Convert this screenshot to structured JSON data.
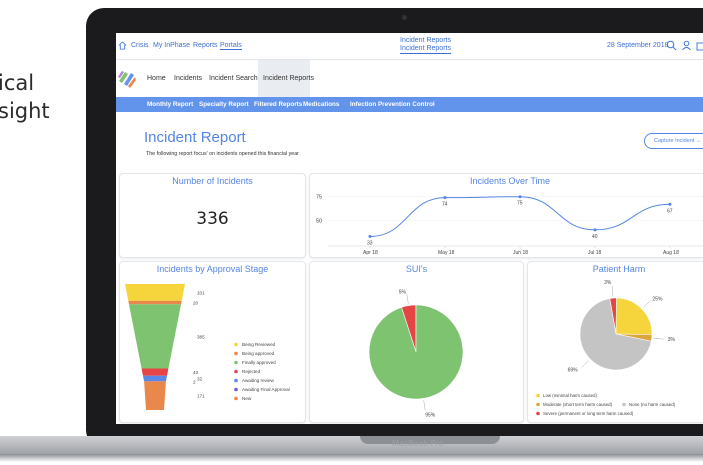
{
  "background_text": [
    "ical",
    "sight"
  ],
  "laptop_label": "MacBook Pro",
  "topbar": {
    "crumbs": [
      "Crisis",
      "My InPhase",
      "Reports",
      "Portals"
    ],
    "center_line1": "Incident Reports",
    "center_line2": "Incident Reports",
    "date": "28 September 2018"
  },
  "nav": [
    "Home",
    "Incidents",
    "Incident Search",
    "Incident Reports"
  ],
  "subnav": [
    "Monthly Report",
    "Specialty Report",
    "Filtered Reports",
    "Medications",
    "Infection Prevention Control"
  ],
  "page": {
    "title": "Incident Report",
    "subtitle": "The following report focus' on incidents opened this financial year",
    "capture_label": "Capture Incident →"
  },
  "cards": {
    "num_title": "Number of Incidents",
    "num_value": "336",
    "time_title": "Incidents Over Time",
    "funnel_title": "Incidents by Approval Stage",
    "sui_title": "SUI's",
    "harm_title": "Patient Harm"
  },
  "colors": {
    "accent": "#5585e6",
    "bluebar": "#6394ec",
    "green": "#7ec36f",
    "red": "#e54545",
    "yellow": "#f5d53b",
    "orange": "#e8884a",
    "purple": "#7b5cd6",
    "gold": "#d9a73b",
    "gray": "#c4c4c4"
  },
  "chart_data": [
    {
      "type": "line",
      "title": "Incidents Over Time",
      "x": [
        "Apr 18",
        "May 18",
        "Jun 18",
        "Jul 18",
        "Aug 18"
      ],
      "values": [
        33,
        74,
        75,
        40,
        67
      ],
      "yticks": [
        75,
        50
      ]
    },
    {
      "type": "bar",
      "title": "Incidents by Approval Stage",
      "categories": [
        "Being Reviewed",
        "Being approved",
        "Finally approved",
        "Rejected",
        "Awaiting review",
        "Awaiting Final Approval",
        "New"
      ],
      "values": [
        101,
        20,
        385,
        43,
        32,
        2,
        171
      ],
      "colors": [
        "#f5d53b",
        "#e8884a",
        "#7ec36f",
        "#e54545",
        "#5b87e6",
        "#7b5cd6",
        "#e8884a"
      ]
    },
    {
      "type": "pie",
      "title": "SUI's",
      "labels": [
        "5%",
        "95%"
      ],
      "values": [
        5,
        95
      ],
      "colors": [
        "#e54545",
        "#7ec36f"
      ]
    },
    {
      "type": "pie",
      "title": "Patient Harm",
      "labels": [
        "3%",
        "25%",
        "3%",
        "69%"
      ],
      "values": [
        3,
        25,
        3,
        69
      ],
      "colors": [
        "#e54545",
        "#f5d53b",
        "#d9a73b",
        "#c4c4c4"
      ],
      "legend": [
        "Low (minimal harm caused)",
        "Moderate (short term harm caused)",
        "None (no harm caused)",
        "Severe (permanent or long term harm caused)"
      ],
      "legend_colors": [
        "#f5d53b",
        "#d9a73b",
        "#c4c4c4",
        "#e54545"
      ]
    }
  ]
}
